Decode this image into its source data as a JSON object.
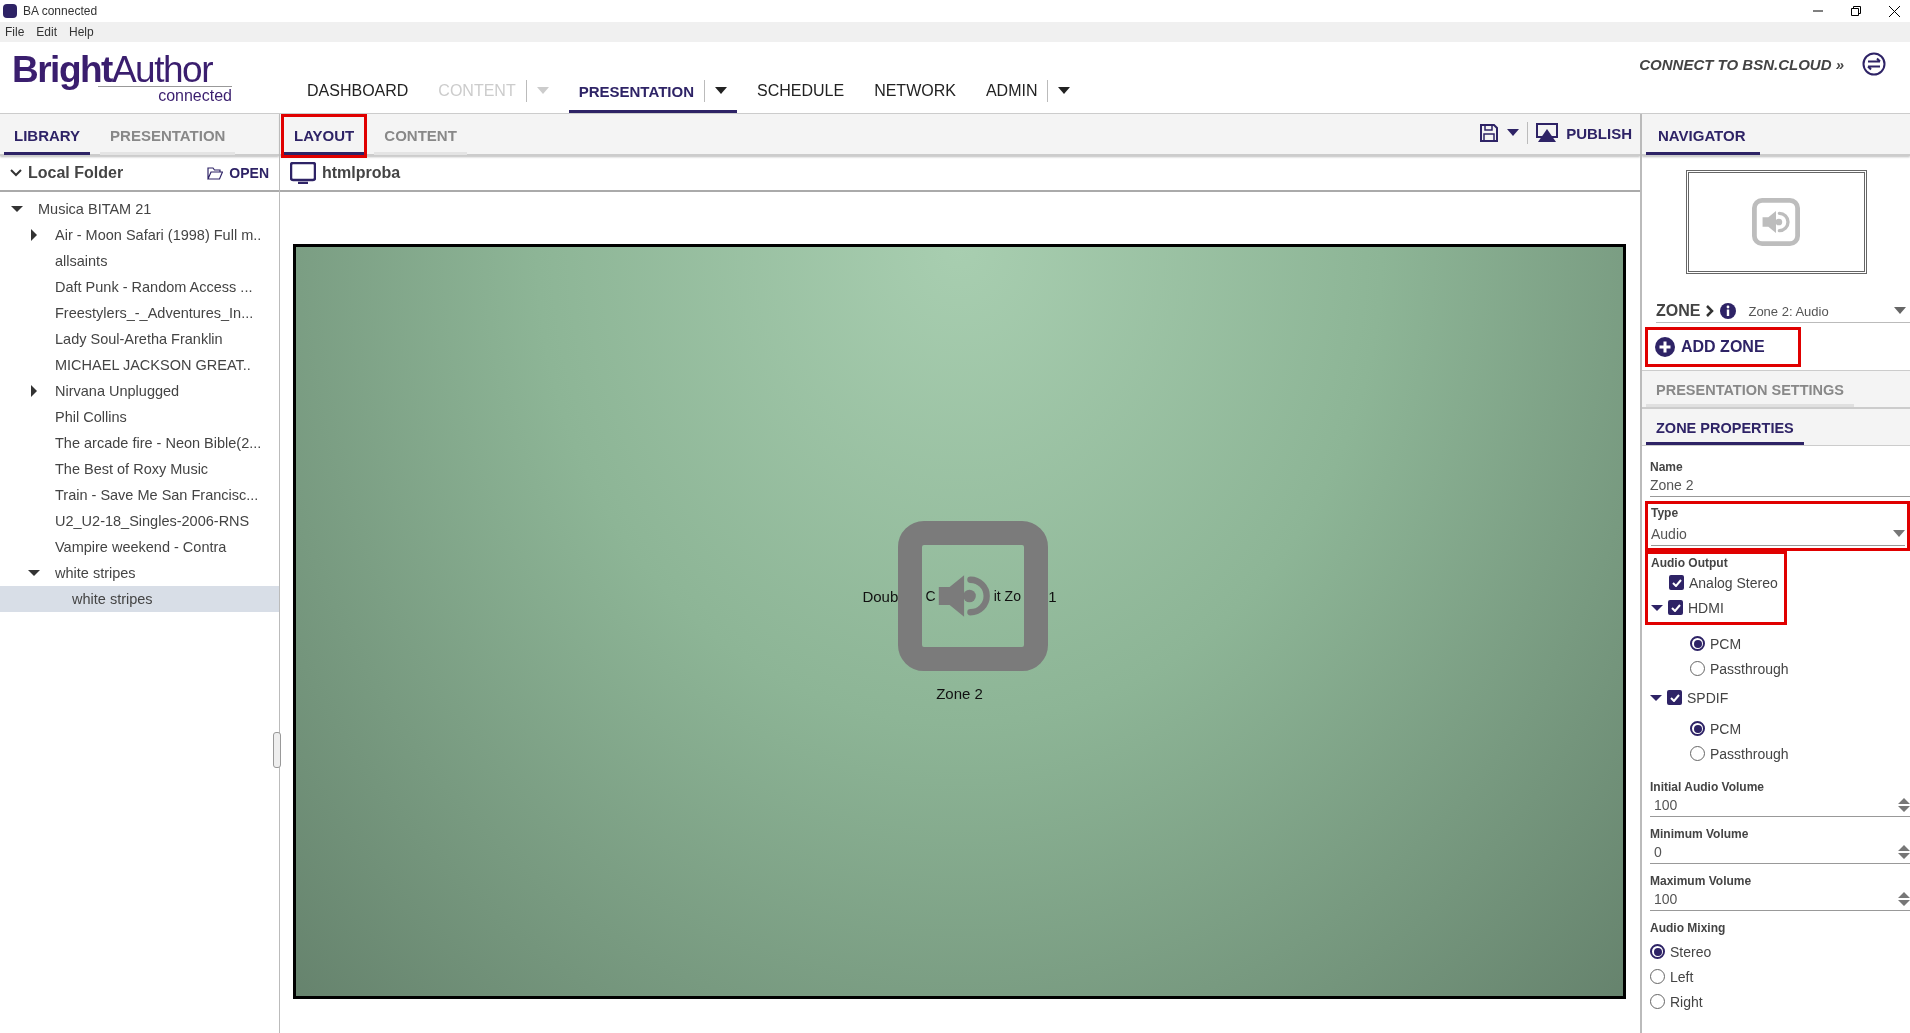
{
  "window": {
    "title": "BA connected"
  },
  "menu": [
    "File",
    "Edit",
    "Help"
  ],
  "logo": {
    "name": "**Bright**Author",
    "sub": "connected"
  },
  "nav": [
    {
      "label": "DASHBOARD",
      "selected": false,
      "disabled": false,
      "dropdown": false
    },
    {
      "label": "CONTENT",
      "selected": false,
      "disabled": true,
      "dropdown": true
    },
    {
      "label": "PRESENTATION",
      "selected": true,
      "disabled": false,
      "dropdown": true
    },
    {
      "label": "SCHEDULE",
      "selected": false,
      "disabled": false,
      "dropdown": false
    },
    {
      "label": "NETWORK",
      "selected": false,
      "disabled": false,
      "dropdown": false
    },
    {
      "label": "ADMIN",
      "selected": false,
      "disabled": false,
      "dropdown": true
    }
  ],
  "connect_link": "CONNECT TO BSN.CLOUD »",
  "library": {
    "tabs": [
      {
        "label": "LIBRARY",
        "selected": true
      },
      {
        "label": "PRESENTATION",
        "selected": false
      }
    ],
    "folder": "Local Folder",
    "open_button": "OPEN",
    "tree": [
      {
        "label": "Musica BITAM 21",
        "kind": "folder",
        "expanded": true,
        "selected": false,
        "children": [
          {
            "label": "Air - Moon Safari (1998) Full m..",
            "kind": "folder",
            "expanded": false,
            "selected": false
          },
          {
            "label": "allsaints",
            "kind": "file",
            "selected": false
          },
          {
            "label": "Daft Punk - Random Access ...",
            "kind": "file",
            "selected": false
          },
          {
            "label": "Freestylers_-_Adventures_In...",
            "kind": "file",
            "selected": false
          },
          {
            "label": "Lady Soul-Aretha Franklin",
            "kind": "file",
            "selected": false
          },
          {
            "label": "MICHAEL JACKSON GREAT..",
            "kind": "file",
            "selected": false
          },
          {
            "label": "Nirvana Unplugged",
            "kind": "folder",
            "expanded": false,
            "selected": false
          },
          {
            "label": "Phil Collins",
            "kind": "file",
            "selected": false
          },
          {
            "label": "The arcade fire - Neon Bible(2...",
            "kind": "file",
            "selected": false
          },
          {
            "label": "The Best of Roxy Music",
            "kind": "file",
            "selected": false
          },
          {
            "label": "Train - Save Me San Francisc...",
            "kind": "file",
            "selected": false
          },
          {
            "label": "U2_U2-18_Singles-2006-RNS",
            "kind": "file",
            "selected": false
          },
          {
            "label": "Vampire weekend - Contra",
            "kind": "file",
            "selected": false
          },
          {
            "label": "white stripes",
            "kind": "folder",
            "expanded": true,
            "selected": false,
            "children": [
              {
                "label": "white stripes",
                "kind": "file",
                "selected": true
              }
            ]
          }
        ]
      }
    ]
  },
  "editor": {
    "tabs": [
      {
        "label": "LAYOUT",
        "selected": true,
        "highlighted": true
      },
      {
        "label": "CONTENT",
        "selected": false,
        "highlighted": false
      }
    ],
    "publish_button": "PUBLISH",
    "presentation_name": "htmlproba",
    "canvas": {
      "zone_hint_parts": [
        "Doub",
        "C",
        "it Zo",
        "1"
      ],
      "zone_label": "Zone 2"
    }
  },
  "navigator": {
    "tab": "NAVIGATOR",
    "zone_crumb": "ZONE",
    "zone_select": "Zone 2: Audio",
    "add_zone": {
      "label": "ADD ZONE",
      "highlighted": true
    },
    "sections": [
      {
        "label": "PRESENTATION SETTINGS",
        "selected": false
      },
      {
        "label": "ZONE PROPERTIES",
        "selected": true
      }
    ],
    "name_field": {
      "label": "Name",
      "value": "Zone 2"
    },
    "type_field": {
      "label": "Type",
      "value": "Audio",
      "highlighted": true
    },
    "audio_output": {
      "label": "Audio Output",
      "highlighted": true,
      "outputs": [
        {
          "label": "Analog Stereo",
          "checked": true
        },
        {
          "label": "HDMI",
          "checked": true,
          "expanded": true,
          "options": [
            {
              "label": "PCM",
              "selected": true
            },
            {
              "label": "Passthrough",
              "selected": false
            }
          ]
        },
        {
          "label": "SPDIF",
          "checked": true,
          "expanded": true,
          "options": [
            {
              "label": "PCM",
              "selected": true
            },
            {
              "label": "Passthrough",
              "selected": false
            }
          ]
        }
      ]
    },
    "volumes": [
      {
        "label": "Initial Audio Volume",
        "value": "100"
      },
      {
        "label": "Minimum Volume",
        "value": "0"
      },
      {
        "label": "Maximum Volume",
        "value": "100"
      }
    ],
    "audio_mixing": {
      "label": "Audio Mixing",
      "options": [
        {
          "label": "Stereo",
          "selected": true
        },
        {
          "label": "Left",
          "selected": false
        },
        {
          "label": "Right",
          "selected": false
        }
      ]
    }
  }
}
